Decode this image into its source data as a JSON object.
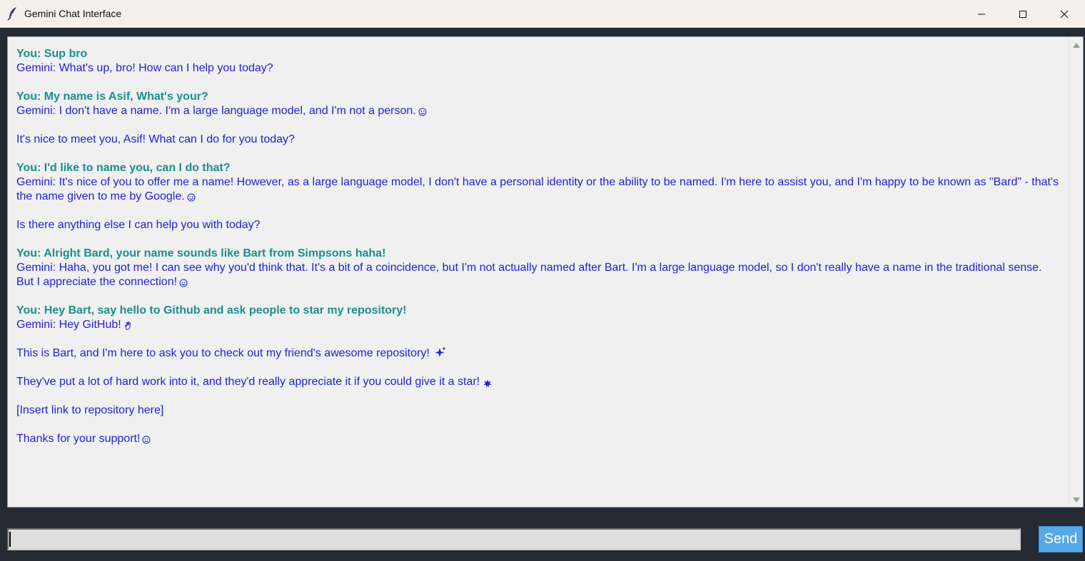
{
  "window": {
    "title": "Gemini Chat Interface",
    "icons": {
      "app": "feather-icon",
      "minimize": "minimize-icon",
      "maximize": "maximize-icon",
      "close": "close-icon"
    }
  },
  "chat": {
    "colors": {
      "user": "#1b8e8e",
      "gemini": "#1f1fd6",
      "background": "#f0f0f0"
    },
    "messages": [
      {
        "you": "You: Sup bro",
        "gemini": [
          "Gemini: What's up, bro! How can I help you today?"
        ]
      },
      {
        "you": "You: My name is Asif, What's your?",
        "gemini": [
          "Gemini: I don't have a name. I'm a large language model, and I'm not a person.",
          "It's nice to meet you, Asif! What can I do for you today?"
        ]
      },
      {
        "you": "You: I'd like to name you, can I do that?",
        "gemini": [
          "Gemini: It's nice of you to offer me a name!  However, as a large language model, I don't have a personal identity or the ability to be named.  I'm here to assist you, and I'm happy to be known as \"Bard\" - that's the name given to me by Google.",
          "Is there anything else I can help you with today?"
        ]
      },
      {
        "you": "You: Alright Bard, your name sounds like Bart from Simpsons haha!",
        "gemini": [
          "Gemini: Haha, you got me!  I can see why you'd think that.  It's a bit of a coincidence, but I'm not actually named after Bart.  I'm a large language model, so I don't really have a name in the traditional sense.  But I appreciate the connection!"
        ]
      },
      {
        "you": "You: Hey Bart, say hello to Github and ask people to star my repository!",
        "gemini": [
          "Gemini: Hey GitHub!",
          "This is Bart, and I'm here to ask you to check out my friend's awesome repository!",
          "They've put a lot of hard work into it, and they'd really appreciate it if you could give it a star!",
          "[Insert link to repository here]",
          "Thanks for your support!"
        ]
      }
    ],
    "emoji_names": {
      "smile": "smile-emoji",
      "wave": "wave-emoji",
      "sparkles": "sparkles-emoji",
      "star": "star-emoji"
    }
  },
  "input": {
    "value": "",
    "placeholder": ""
  },
  "send": {
    "label": "Send",
    "color": "#56a9e8"
  }
}
